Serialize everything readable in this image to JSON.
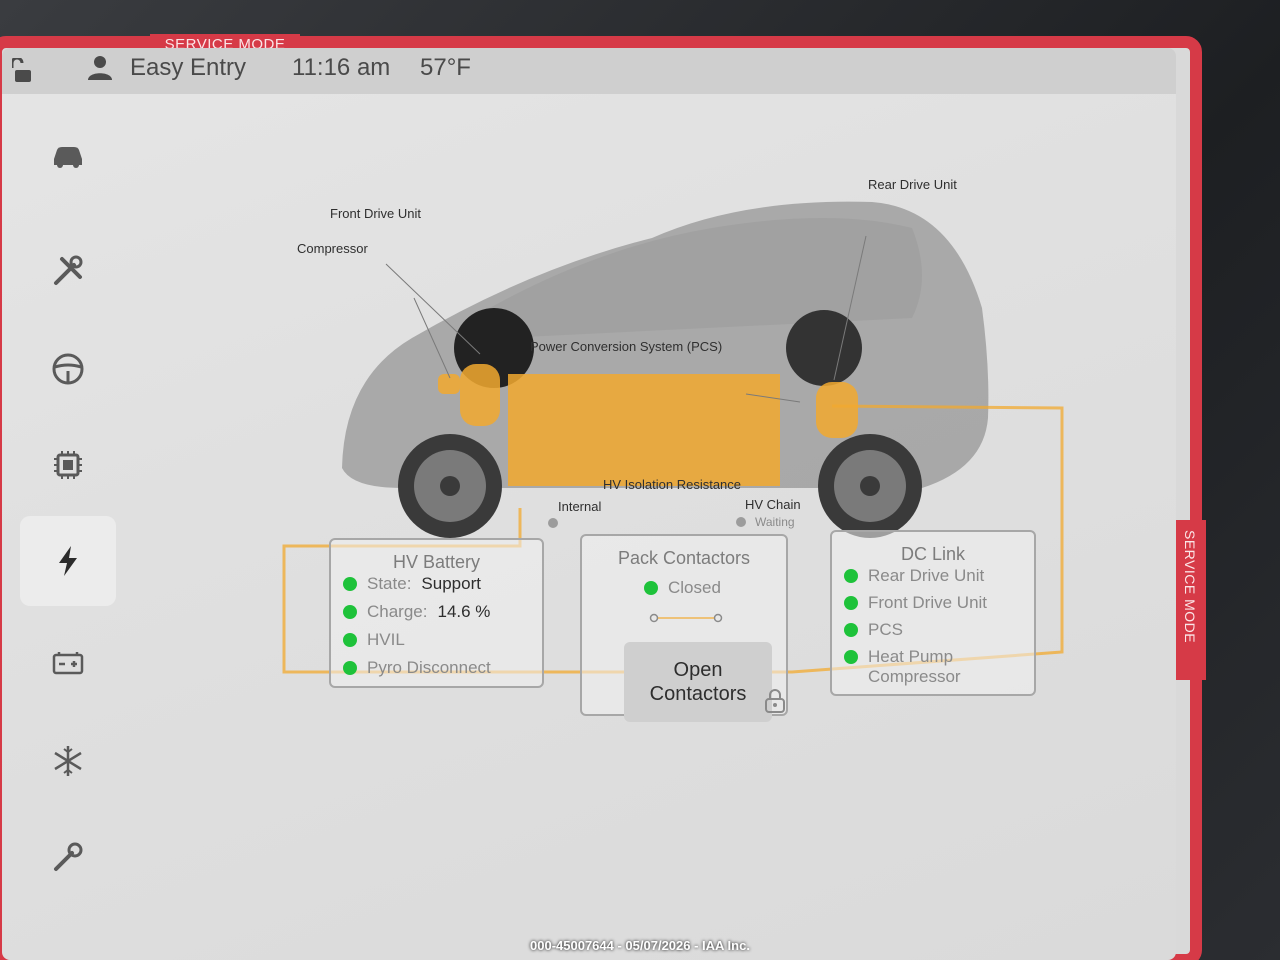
{
  "service_mode": {
    "top_label": "SERVICE MODE",
    "side_label": "SERVICE MODE",
    "color": "#d63a47"
  },
  "status_bar": {
    "profile": "Easy Entry",
    "time": "11:16 am",
    "temperature": "57°F",
    "icons": [
      "lock-open-icon",
      "person-icon"
    ]
  },
  "sidebar": {
    "items": [
      {
        "name": "car-icon"
      },
      {
        "name": "tools-icon"
      },
      {
        "name": "steering-wheel-icon"
      },
      {
        "name": "chip-icon"
      },
      {
        "name": "lightning-icon",
        "active": true
      },
      {
        "name": "battery-icon"
      },
      {
        "name": "snowflake-icon"
      },
      {
        "name": "wrench-icon"
      }
    ]
  },
  "vehicle_diagram": {
    "callouts": {
      "front_drive_unit": "Front Drive Unit",
      "compressor": "Compressor",
      "rear_drive_unit": "Rear Drive Unit",
      "pcs": "Power Conversion System (PCS)"
    },
    "highlight_color": "#f2a92f"
  },
  "isolation": {
    "title": "HV Isolation Resistance",
    "internal": "Internal",
    "hv_chain": "HV Chain",
    "hv_chain_status": "Waiting"
  },
  "hv_battery": {
    "title": "HV Battery",
    "state_label": "State:",
    "state_value": "Support",
    "charge_label": "Charge:",
    "charge_value": "14.6 %",
    "hvil": "HVIL",
    "pyro": "Pyro Disconnect"
  },
  "pack_contactors": {
    "title": "Pack Contactors",
    "status": "Closed",
    "button_line1": "Open",
    "button_line2": "Contactors"
  },
  "dc_link": {
    "title": "DC Link",
    "items": [
      "Rear Drive Unit",
      "Front Drive Unit",
      "PCS",
      "Heat Pump",
      "Compressor"
    ]
  },
  "watermark": "000-45007644 - 05/07/2026 - IAA Inc.",
  "status_color": "#1ec23a"
}
